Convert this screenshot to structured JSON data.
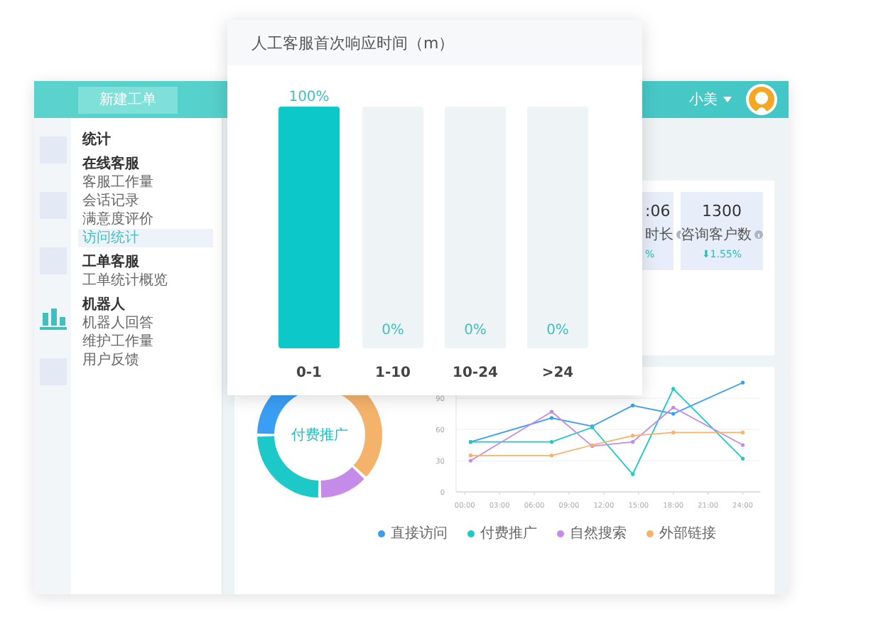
{
  "header": {
    "new_ticket_button": "新建工单",
    "user_name": "小美"
  },
  "rail": {
    "items": [
      {
        "kind": "blank",
        "selected": false
      },
      {
        "kind": "blank",
        "selected": false
      },
      {
        "kind": "blank",
        "selected": false
      },
      {
        "kind": "chart",
        "selected": true
      },
      {
        "kind": "blank",
        "selected": false
      }
    ]
  },
  "nav": {
    "title": "统计",
    "sections": [
      {
        "title": "在线客服",
        "items": [
          {
            "label": "客服工作量",
            "selected": false
          },
          {
            "label": "会话记录",
            "selected": false
          },
          {
            "label": "满意度评价",
            "selected": false
          },
          {
            "label": "访问统计",
            "selected": true
          }
        ]
      },
      {
        "title": "工单客服",
        "items": [
          {
            "label": "工单统计概览",
            "selected": false
          }
        ]
      },
      {
        "title": "机器人",
        "items": [
          {
            "label": "机器人回答",
            "selected": false
          },
          {
            "label": "维护工作量",
            "selected": false
          },
          {
            "label": "用户反馈",
            "selected": false
          }
        ]
      }
    ]
  },
  "stats": [
    {
      "value": ":06",
      "label": "时长",
      "change": "%"
    },
    {
      "value": "1300",
      "label": "咨询客户数",
      "change": "⬇1.55%"
    }
  ],
  "popup": {
    "title": "人工客服首次响应时间（m）",
    "chart_data": {
      "type": "bar",
      "categories": [
        "0-1",
        "1-10",
        "10-24",
        ">24"
      ],
      "values": [
        100,
        0,
        0,
        0
      ],
      "ylim": [
        0,
        100
      ],
      "value_labels": [
        "100%",
        "0%",
        "0%",
        "0%"
      ]
    }
  },
  "donut": {
    "center_label": "付费推广"
  },
  "line_chart": {
    "chart_data": {
      "type": "line",
      "x": [
        0.5,
        7.5,
        11,
        14.5,
        18,
        24
      ],
      "xlim": [
        -0.75,
        25.5
      ],
      "ylim": [
        0,
        110
      ],
      "grid": true,
      "xticks": [
        {
          "value": 0,
          "label": "00:00"
        },
        {
          "value": 3,
          "label": "03:00"
        },
        {
          "value": 6,
          "label": "06:00"
        },
        {
          "value": 9,
          "label": "09:00"
        },
        {
          "value": 12,
          "label": "12:00"
        },
        {
          "value": 15,
          "label": "15:00"
        },
        {
          "value": 18,
          "label": "18:00"
        },
        {
          "value": 21,
          "label": "21:00"
        },
        {
          "value": 24,
          "label": "24:00"
        }
      ],
      "yticks": [
        0,
        30,
        60,
        90
      ],
      "series": [
        {
          "name": "直接访问",
          "color": "#3a9ef5",
          "values": [
            48,
            71,
            63,
            83,
            75,
            105
          ]
        },
        {
          "name": "付费推广",
          "color": "#1cc8c8",
          "values": [
            48,
            48,
            62,
            17,
            99,
            32
          ]
        },
        {
          "name": "自然搜索",
          "color": "#c48be8",
          "values": [
            30,
            77,
            44,
            48,
            81,
            45
          ]
        },
        {
          "name": "外部链接",
          "color": "#f5b26b",
          "values": [
            35,
            35,
            45,
            54,
            57,
            57
          ]
        }
      ]
    }
  }
}
